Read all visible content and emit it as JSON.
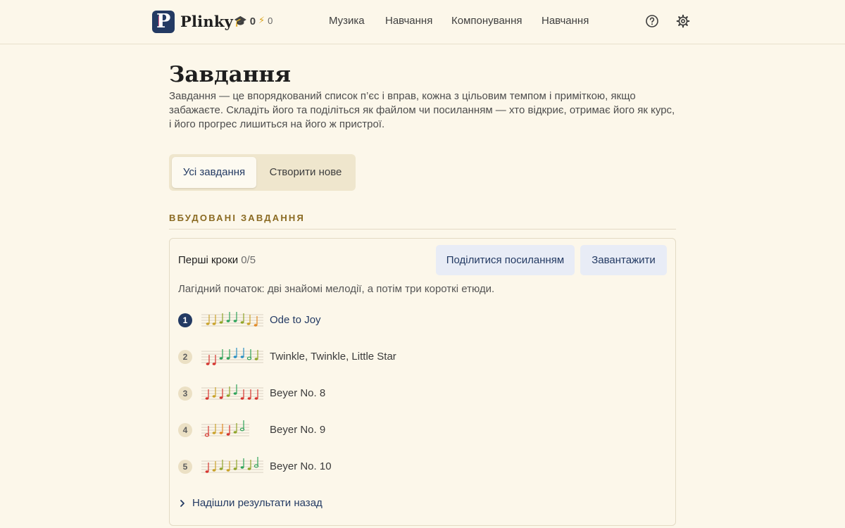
{
  "header": {
    "brand": "Plinky",
    "streak_count": "0",
    "energy_count": "0",
    "nav": [
      "Музика",
      "Навчання",
      "Компонування",
      "Навчання"
    ],
    "icons": {
      "help": "help-circle-icon",
      "settings": "gear-icon"
    }
  },
  "page": {
    "title": "Завдання",
    "intro": "Завдання — це впорядкований список п’єс і вправ, кожна з цільовим темпом і приміткою, якщо забажаєте. Складіть його та поділіться як файлом чи посиланням — хто відкриє, отримає його як курс, і його прогрес лишиться на його ж пристрої."
  },
  "tabs": [
    "Усі завдання",
    "Створити нове"
  ],
  "section": {
    "label": "ВБУДОВАНІ ЗАВДАННЯ"
  },
  "assignment": {
    "title": "Перші кроки",
    "progress": "0/5",
    "share_label": "Поділитися посиланням",
    "download_label": "Завантажити",
    "description": "Лагідний початок: дві знайомі мелодії, а потім три короткі етюди.",
    "items": [
      {
        "number": "1",
        "label": "Ode to Joy",
        "active": true
      },
      {
        "number": "2",
        "label": "Twinkle, Twinkle, Little Star",
        "active": false
      },
      {
        "number": "3",
        "label": "Beyer No. 8",
        "active": false
      },
      {
        "number": "4",
        "label": "Beyer No. 9",
        "active": false
      },
      {
        "number": "5",
        "label": "Beyer No. 10",
        "active": false
      }
    ],
    "results_label": "Надішли результати назад"
  },
  "colors": {
    "background": "#fcf7ea",
    "accent": "#233a63",
    "brand_pink": "#e0336e",
    "section_label": "#8a6a22",
    "button_bg": "#e8ecf6",
    "note_palette": [
      "#c9a22a",
      "#8fa52a",
      "#2fa35a",
      "#2b8fc2",
      "#4a6bd1",
      "#d6352f",
      "#e08a26"
    ]
  }
}
